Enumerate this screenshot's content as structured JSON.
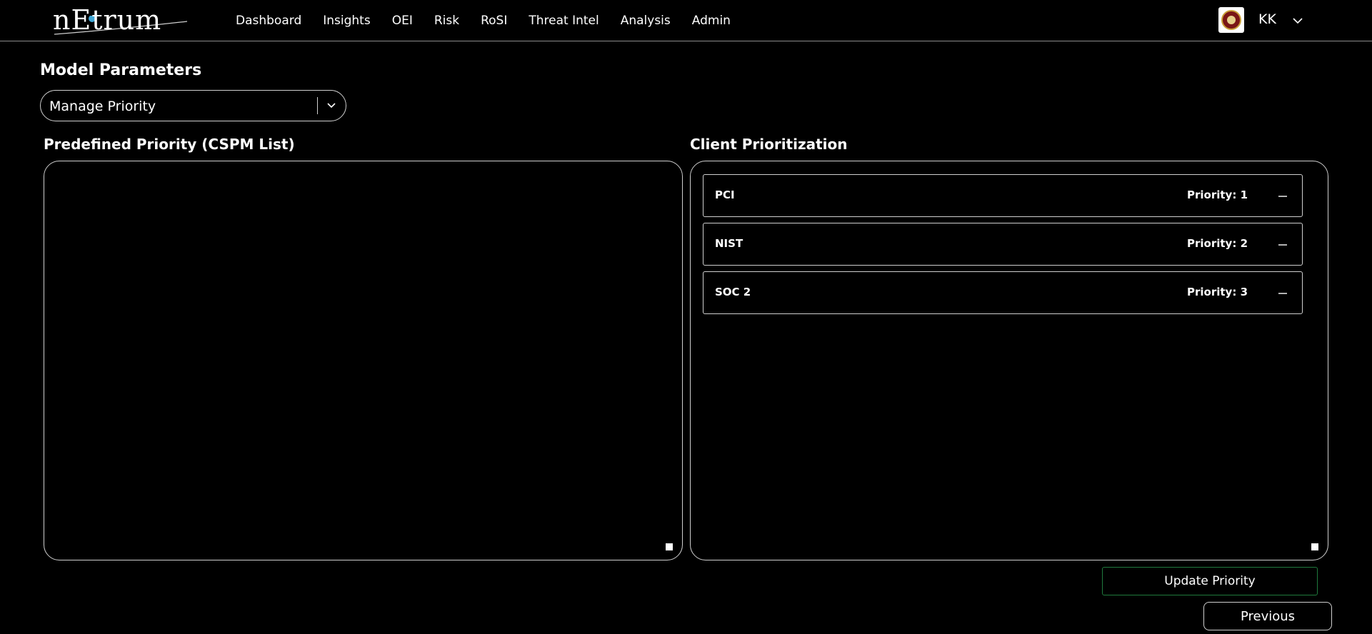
{
  "brand": {
    "logo_text": "nEtrum"
  },
  "nav": {
    "items": [
      {
        "label": "Dashboard"
      },
      {
        "label": "Insights"
      },
      {
        "label": "OEI"
      },
      {
        "label": "Risk"
      },
      {
        "label": "RoSI"
      },
      {
        "label": "Threat Intel"
      },
      {
        "label": "Analysis"
      },
      {
        "label": "Admin"
      }
    ]
  },
  "user": {
    "initials": "KK"
  },
  "page": {
    "title": "Model Parameters",
    "select": {
      "value": "Manage Priority"
    }
  },
  "predefined": {
    "title": "Predefined Priority (CSPM List)",
    "items": []
  },
  "client": {
    "title": "Client Prioritization",
    "priority_label": "Priority:",
    "items": [
      {
        "name": "PCI",
        "priority": "1"
      },
      {
        "name": "NIST",
        "priority": "2"
      },
      {
        "name": "SOC 2",
        "priority": "3"
      }
    ]
  },
  "actions": {
    "update_label": "Update Priority",
    "previous_label": "Previous"
  },
  "colors": {
    "background": "#000000",
    "text": "#ffffff",
    "border": "#cfcfcf",
    "update_border": "#1f7a3d"
  }
}
